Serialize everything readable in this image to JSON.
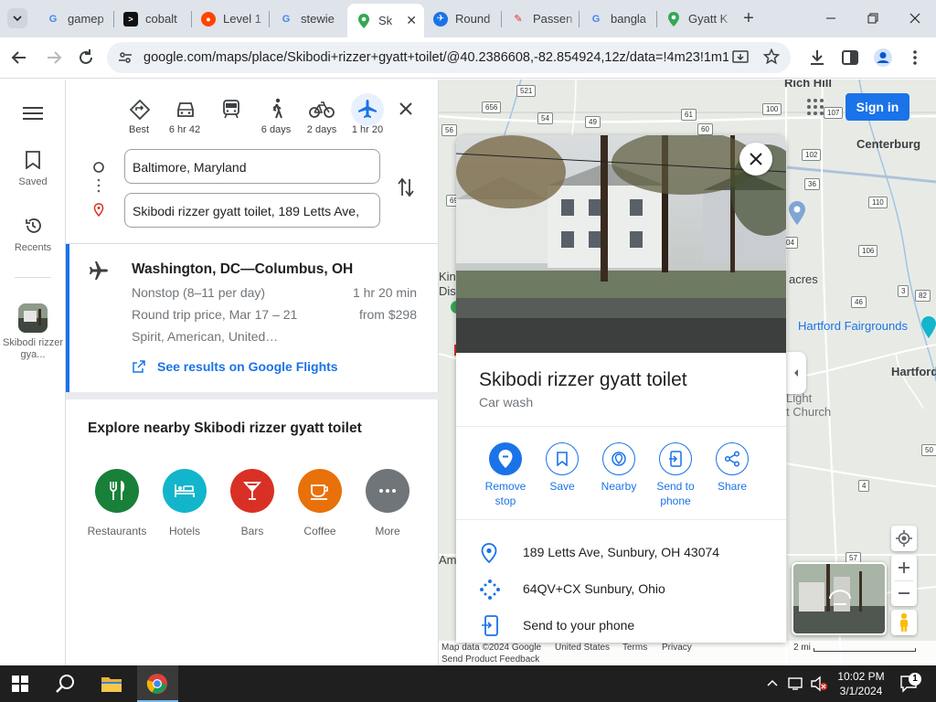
{
  "browser": {
    "tabs": [
      {
        "label": "gamep",
        "icon": "google-icon"
      },
      {
        "label": "cobalt",
        "icon": "cobalt-icon"
      },
      {
        "label": "Level 1",
        "icon": "reddit-icon"
      },
      {
        "label": "stewie",
        "icon": "google-icon"
      },
      {
        "label": "Sk",
        "icon": "maps-icon",
        "active": true
      },
      {
        "label": "Round",
        "icon": "flight-icon"
      },
      {
        "label": "Passen",
        "icon": "site-icon"
      },
      {
        "label": "bangla",
        "icon": "google-icon"
      },
      {
        "label": "Gyatt K",
        "icon": "maps-icon"
      }
    ],
    "new_tab": "+",
    "url": "google.com/maps/place/Skibodi+rizzer+gyatt+toilet/@40.2386608,-82.854924,12z/data=!4m23!1m1..."
  },
  "rail": {
    "saved_label": "Saved",
    "recents_label": "Recents",
    "recent_place_label": "Skibodi rizzer gya..."
  },
  "directions": {
    "modes": [
      {
        "name": "best",
        "label": "Best"
      },
      {
        "name": "drive",
        "label": "6 hr 42"
      },
      {
        "name": "transit",
        "label": ""
      },
      {
        "name": "walk",
        "label": "6 days"
      },
      {
        "name": "bike",
        "label": "2 days"
      },
      {
        "name": "flight",
        "label": "1 hr 20"
      }
    ],
    "origin": "Baltimore, Maryland",
    "destination": "Skibodi rizzer gyatt toilet, 189 Letts Ave,",
    "flight": {
      "route": "Washington, DC—Columbus, OH",
      "nonstop": "Nonstop (8–11 per day)",
      "duration": "1 hr 20 min",
      "price_label": "Round trip price, Mar 17 – 21",
      "price": "from $298",
      "airlines": "Spirit, American, United…",
      "link": "See results on Google Flights"
    },
    "explore_title": "Explore nearby Skibodi rizzer gyatt toilet",
    "categories": [
      {
        "label": "Restaurants",
        "color": "#188038"
      },
      {
        "label": "Hotels",
        "color": "#12b5cb"
      },
      {
        "label": "Bars",
        "color": "#d93025"
      },
      {
        "label": "Coffee",
        "color": "#e8710a"
      },
      {
        "label": "More",
        "color": "#70757a"
      }
    ]
  },
  "map": {
    "sign_in": "Sign in",
    "labels": {
      "rich_hill": "Rich Hill",
      "centerburg": "Centerburg",
      "acres": "acres",
      "fairgrounds": "Hartford Fairgrounds",
      "hartford": "Hartford",
      "light": "Light",
      "church": "t Church",
      "kin": "Kin",
      "dis": "Dis",
      "am": "Am"
    },
    "shields": [
      "521",
      "656",
      "54",
      "49",
      "61",
      "60",
      "100",
      "107",
      "102",
      "36",
      "110",
      "106",
      "3",
      "82",
      "46",
      "56",
      "69",
      "04",
      "50",
      "4",
      "57"
    ],
    "footer": {
      "data": "Map data ©2024 Google",
      "country": "United States",
      "terms": "Terms",
      "privacy": "Privacy",
      "feedback": "Send Product Feedback",
      "scale": "2 mi"
    }
  },
  "place": {
    "name": "Skibodi rizzer gyatt toilet",
    "category": "Car wash",
    "actions": [
      {
        "label": "Remove stop"
      },
      {
        "label": "Save"
      },
      {
        "label": "Nearby"
      },
      {
        "label": "Send to phone"
      },
      {
        "label": "Share"
      }
    ],
    "address": "189 Letts Ave, Sunbury, OH 43074",
    "plus_code": "64QV+CX Sunbury, Ohio",
    "send_phone": "Send to your phone"
  },
  "taskbar": {
    "time": "10:02 PM",
    "date": "3/1/2024",
    "notification_count": "1"
  },
  "colors": {
    "accent": "#1a73e8",
    "map_bg": "#e8ebe5",
    "taskbar": "#1f1f1f",
    "tabstrip": "#dfe3ea"
  }
}
